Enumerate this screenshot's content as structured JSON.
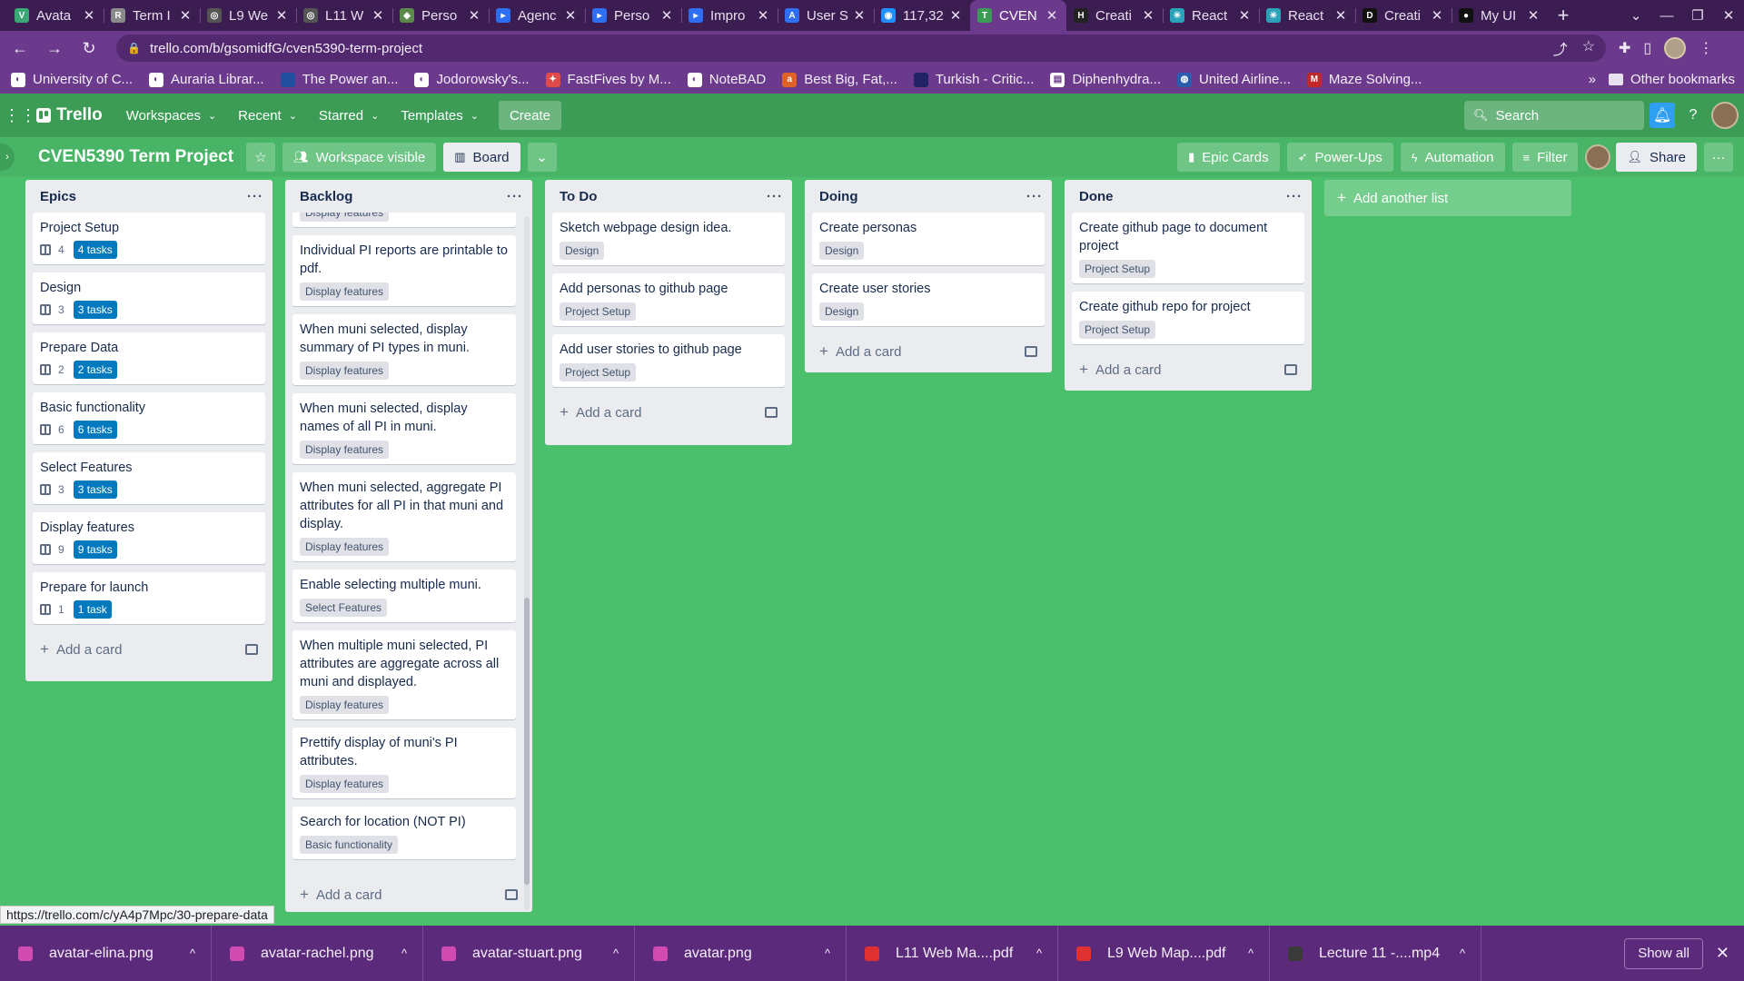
{
  "browser": {
    "tabs": [
      {
        "title": "Avata",
        "color": "#3aa776",
        "glyph": "V"
      },
      {
        "title": "Term I",
        "color": "#8a8a8a",
        "glyph": "R"
      },
      {
        "title": "L9 We",
        "color": "#555555",
        "glyph": "◎"
      },
      {
        "title": "L11 W",
        "color": "#555555",
        "glyph": "◎"
      },
      {
        "title": "Perso",
        "color": "#5b8a4a",
        "glyph": "◆"
      },
      {
        "title": "Agenc",
        "color": "#2d6ef2",
        "glyph": "▸"
      },
      {
        "title": "Perso",
        "color": "#2d6ef2",
        "glyph": "▸"
      },
      {
        "title": "Impro",
        "color": "#2d6ef2",
        "glyph": "▸"
      },
      {
        "title": "User S",
        "color": "#2d6ef2",
        "glyph": "A"
      },
      {
        "title": "117,32",
        "color": "#1e90ff",
        "glyph": "◉"
      },
      {
        "title": "CVEN",
        "color": "#3c9c55",
        "glyph": "T",
        "active": true
      },
      {
        "title": "Creati",
        "color": "#222222",
        "glyph": "H"
      },
      {
        "title": "React",
        "color": "#2aa3b8",
        "glyph": "✳"
      },
      {
        "title": "React",
        "color": "#2aa3b8",
        "glyph": "✳"
      },
      {
        "title": "Creati",
        "color": "#111111",
        "glyph": "D"
      },
      {
        "title": "My UI",
        "color": "#111111",
        "glyph": "●"
      }
    ],
    "new_tab": "+",
    "url": "trello.com/b/gsomidfG/cven5390-term-project",
    "bookmarks": [
      {
        "label": "University of C...",
        "color": "#ffffff",
        "glyph": "◐"
      },
      {
        "label": "Auraria Librar...",
        "color": "#ffffff",
        "glyph": "◐"
      },
      {
        "label": "The Power an...",
        "color": "#1f4e9c",
        "glyph": ""
      },
      {
        "label": "Jodorowsky's...",
        "color": "#ffffff",
        "glyph": "◐"
      },
      {
        "label": "FastFives by M...",
        "color": "#e04a4a",
        "glyph": "✦"
      },
      {
        "label": "NoteBAD",
        "color": "#ffffff",
        "glyph": "◐"
      },
      {
        "label": "Best Big, Fat,...",
        "color": "#e0602a",
        "glyph": "a"
      },
      {
        "label": "Turkish - Critic...",
        "color": "#222266",
        "glyph": ""
      },
      {
        "label": "Diphenhydra...",
        "color": "#ffffff",
        "glyph": "▤"
      },
      {
        "label": "United Airline...",
        "color": "#2a5db0",
        "glyph": "◍"
      },
      {
        "label": "Maze Solving...",
        "color": "#c0282c",
        "glyph": "M"
      }
    ],
    "bookmarks_more": "»",
    "other_bookmarks": "Other bookmarks"
  },
  "trello": {
    "logo": "Trello",
    "menus": [
      "Workspaces",
      "Recent",
      "Starred",
      "Templates"
    ],
    "create": "Create",
    "search_placeholder": "Search"
  },
  "board": {
    "title": "CVEN5390 Term Project",
    "visibility": "Workspace visible",
    "view": "Board",
    "epic_cards": "Epic Cards",
    "power_ups": "Power-Ups",
    "automation": "Automation",
    "filter": "Filter",
    "share": "Share",
    "add_card": "Add a card",
    "add_list": "Add another list",
    "lists": [
      {
        "title": "Epics",
        "cards": [
          {
            "title": "Project Setup",
            "count": "4",
            "tasks": "4 tasks"
          },
          {
            "title": "Design",
            "count": "3",
            "tasks": "3 tasks"
          },
          {
            "title": "Prepare Data",
            "count": "2",
            "tasks": "2 tasks"
          },
          {
            "title": "Basic functionality",
            "count": "6",
            "tasks": "6 tasks"
          },
          {
            "title": "Select Features",
            "count": "3",
            "tasks": "3 tasks"
          },
          {
            "title": "Display features",
            "count": "9",
            "tasks": "9 tasks"
          },
          {
            "title": "Prepare for launch",
            "count": "1",
            "tasks": "1 task"
          }
        ]
      },
      {
        "title": "Backlog",
        "cards": [
          {
            "title": "Individual PI reports are printable to pdf.",
            "label": "Display features"
          },
          {
            "title": "When muni selected, display summary of PI types in muni.",
            "label": "Display features"
          },
          {
            "title": "When muni selected, display names of all PI in muni.",
            "label": "Display features"
          },
          {
            "title": "When muni selected, aggregate PI attributes for all PI in that muni and display.",
            "label": "Display features"
          },
          {
            "title": "Enable selecting multiple muni.",
            "label": "Select Features"
          },
          {
            "title": "When multiple muni selected, PI attributes are aggregate across all muni and displayed.",
            "label": "Display features"
          },
          {
            "title": "Prettify display of muni's PI attributes.",
            "label": "Display features"
          },
          {
            "title": "Search for location (NOT PI)",
            "label": "Basic functionality"
          }
        ],
        "peek_label": "Display features"
      },
      {
        "title": "To Do",
        "cards": [
          {
            "title": "Sketch webpage design idea.",
            "label": "Design"
          },
          {
            "title": "Add personas to github page",
            "label": "Project Setup"
          },
          {
            "title": "Add user stories to github page",
            "label": "Project Setup"
          }
        ]
      },
      {
        "title": "Doing",
        "cards": [
          {
            "title": "Create personas",
            "label": "Design"
          },
          {
            "title": "Create user stories",
            "label": "Design"
          }
        ]
      },
      {
        "title": "Done",
        "cards": [
          {
            "title": "Create github page to document project",
            "label": "Project Setup"
          },
          {
            "title": "Create github repo for project",
            "label": "Project Setup"
          }
        ]
      }
    ]
  },
  "status_url": "https://trello.com/c/yA4p7Mpc/30-prepare-data",
  "downloads": {
    "items": [
      {
        "name": "avatar-elina.png",
        "color": "#d04ab0"
      },
      {
        "name": "avatar-rachel.png",
        "color": "#d04ab0"
      },
      {
        "name": "avatar-stuart.png",
        "color": "#d04ab0"
      },
      {
        "name": "avatar.png",
        "color": "#d04ab0"
      },
      {
        "name": "L11 Web Ma....pdf",
        "color": "#e03030"
      },
      {
        "name": "L9 Web Map....pdf",
        "color": "#e03030"
      },
      {
        "name": "Lecture 11 -....mp4",
        "color": "#3a3a3a"
      }
    ],
    "show_all": "Show all"
  }
}
